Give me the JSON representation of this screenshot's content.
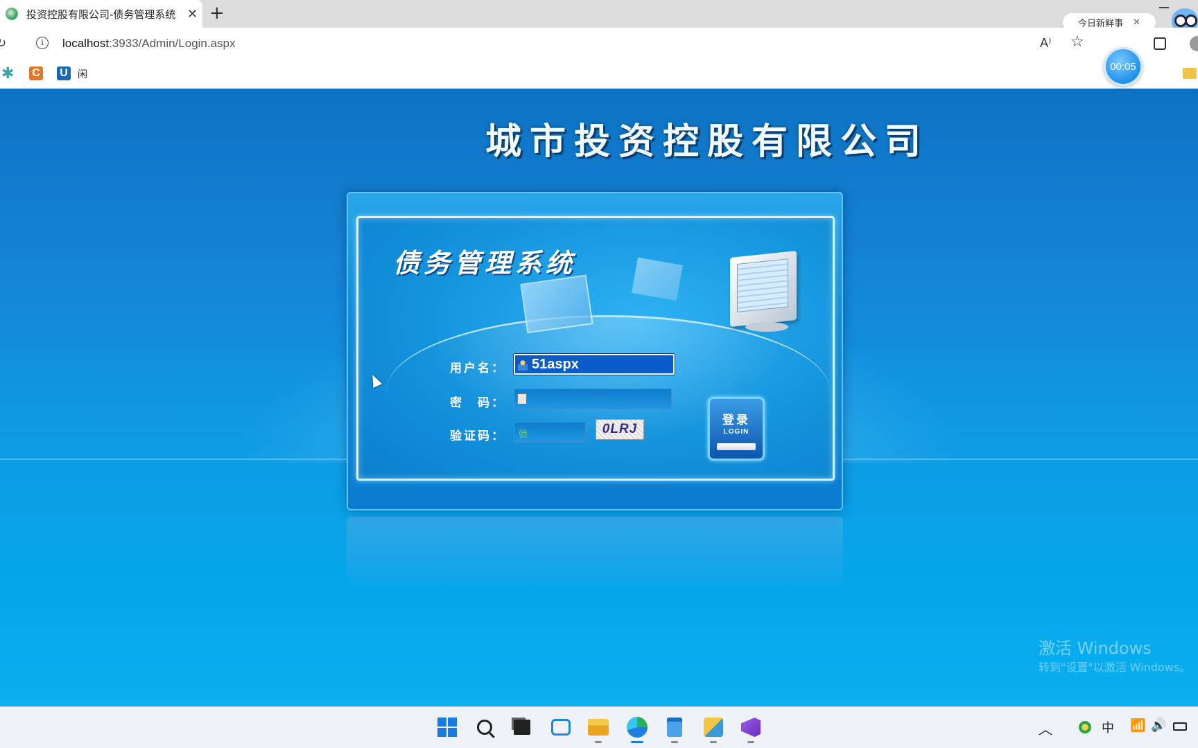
{
  "browser": {
    "tab_title": "投资控股有限公司-债务管理系统",
    "tab_close": "✕",
    "new_tab": "+",
    "news_pill": "今日新鲜事",
    "news_close": "✕",
    "url_host": "localhost",
    "url_rest": ":3933/Admin/Login.aspx",
    "bookmark_label": "闲",
    "bookmark_c": "C",
    "bookmark_u": "U",
    "timer": "00:05",
    "readaloud_glyph": "A⁾",
    "favorite_glyph": "☆"
  },
  "page": {
    "company_title": "城市投资控股有限公司",
    "system_title": "债务管理系统",
    "form": {
      "username_label": "用户名：",
      "username_value": "51aspx",
      "password_label": "密　码：",
      "password_value": "",
      "captcha_label": "验证码：",
      "captcha_input_hint": "验",
      "captcha_value": "0LRJ"
    },
    "login_button": {
      "zh": "登录",
      "en": "LOGIN"
    }
  },
  "watermark": {
    "line1": "激活 Windows",
    "line2": "转到\"设置\"以激活 Windows。"
  },
  "taskbar": {
    "items": [
      "start-icon",
      "search-icon",
      "task-view-icon",
      "widgets-icon",
      "file-explorer-icon",
      "edge-icon",
      "notepad-icon",
      "snipping-tool-icon",
      "visual-studio-icon"
    ],
    "tray": {
      "chevron": "︿",
      "ime": "中",
      "wifi": "📶",
      "volume": "🔊"
    }
  },
  "colors": {
    "page_top": "#0e72c4",
    "page_bottom": "#0ab0f0",
    "accent": "#1a7be0"
  }
}
